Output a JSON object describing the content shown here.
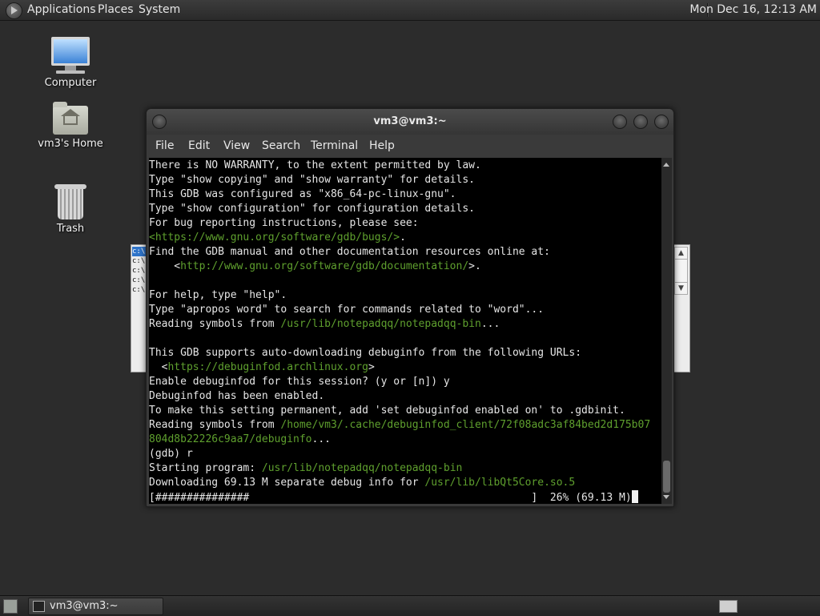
{
  "top_panel": {
    "menus": [
      "Applications",
      "Places",
      "System"
    ],
    "clock": "Mon Dec 16, 12:13 AM",
    "logo_icon": "gnome-foot-icon"
  },
  "desktop": {
    "icons": [
      {
        "label": "Computer",
        "icon": "computer-icon"
      },
      {
        "label": "vm3's Home",
        "icon": "home-folder-icon"
      },
      {
        "label": "Trash",
        "icon": "trash-icon"
      }
    ]
  },
  "background_window": {
    "lines": [
      "c:\\",
      "c:\\",
      "c:\\",
      "c:\\",
      "c:\\"
    ],
    "scroll_up": "▲",
    "scroll_down": "▼"
  },
  "terminal": {
    "title": "vm3@vm3:~",
    "menus": [
      "File",
      "Edit",
      "View",
      "Search",
      "Terminal",
      "Help"
    ],
    "lines": [
      [
        {
          "t": "There is NO WARRANTY, to the extent permitted by law."
        }
      ],
      [
        {
          "t": "Type \"show copying\" and \"show warranty\" for details."
        }
      ],
      [
        {
          "t": "This GDB was configured as \"x86_64-pc-linux-gnu\"."
        }
      ],
      [
        {
          "t": "Type \"show configuration\" for configuration details."
        }
      ],
      [
        {
          "t": "For bug reporting instructions, please see:"
        }
      ],
      [
        {
          "t": "<https://www.gnu.org/software/gdb/bugs/>",
          "g": true
        },
        {
          "t": "."
        }
      ],
      [
        {
          "t": "Find the GDB manual and other documentation resources online at:"
        }
      ],
      [
        {
          "t": "    <"
        },
        {
          "t": "http://www.gnu.org/software/gdb/documentation/",
          "g": true
        },
        {
          "t": ">."
        }
      ],
      [
        {
          "t": ""
        }
      ],
      [
        {
          "t": "For help, type \"help\"."
        }
      ],
      [
        {
          "t": "Type \"apropos word\" to search for commands related to \"word\"..."
        }
      ],
      [
        {
          "t": "Reading symbols from "
        },
        {
          "t": "/usr/lib/notepadqq/notepadqq-bin",
          "g": true
        },
        {
          "t": "..."
        }
      ],
      [
        {
          "t": ""
        }
      ],
      [
        {
          "t": "This GDB supports auto-downloading debuginfo from the following URLs:"
        }
      ],
      [
        {
          "t": "  <"
        },
        {
          "t": "https://debuginfod.archlinux.org",
          "g": true
        },
        {
          "t": ">"
        }
      ],
      [
        {
          "t": "Enable debuginfod for this session? (y or [n]) y"
        }
      ],
      [
        {
          "t": "Debuginfod has been enabled."
        }
      ],
      [
        {
          "t": "To make this setting permanent, add 'set debuginfod enabled on' to .gdbinit."
        }
      ],
      [
        {
          "t": "Reading symbols from "
        },
        {
          "t": "/home/vm3/.cache/debuginfod_client/72f08adc3af84bed2d175b07",
          "g": true
        }
      ],
      [
        {
          "t": "804d8b22226c9aa7/debuginfo",
          "g": true
        },
        {
          "t": "..."
        }
      ],
      [
        {
          "t": "(gdb) r"
        }
      ],
      [
        {
          "t": "Starting program: "
        },
        {
          "t": "/usr/lib/notepadqq/notepadqq-bin",
          "g": true
        }
      ],
      [
        {
          "t": "Downloading 69.13 M separate debug info for "
        },
        {
          "t": "/usr/lib/libQt5Core.so.5",
          "g": true
        }
      ],
      [
        {
          "t": "[###############                                             ]  26% (69.13 M)"
        }
      ]
    ],
    "download_progress_percent": 26
  },
  "bottom_panel": {
    "task_label": "vm3@vm3:~"
  }
}
